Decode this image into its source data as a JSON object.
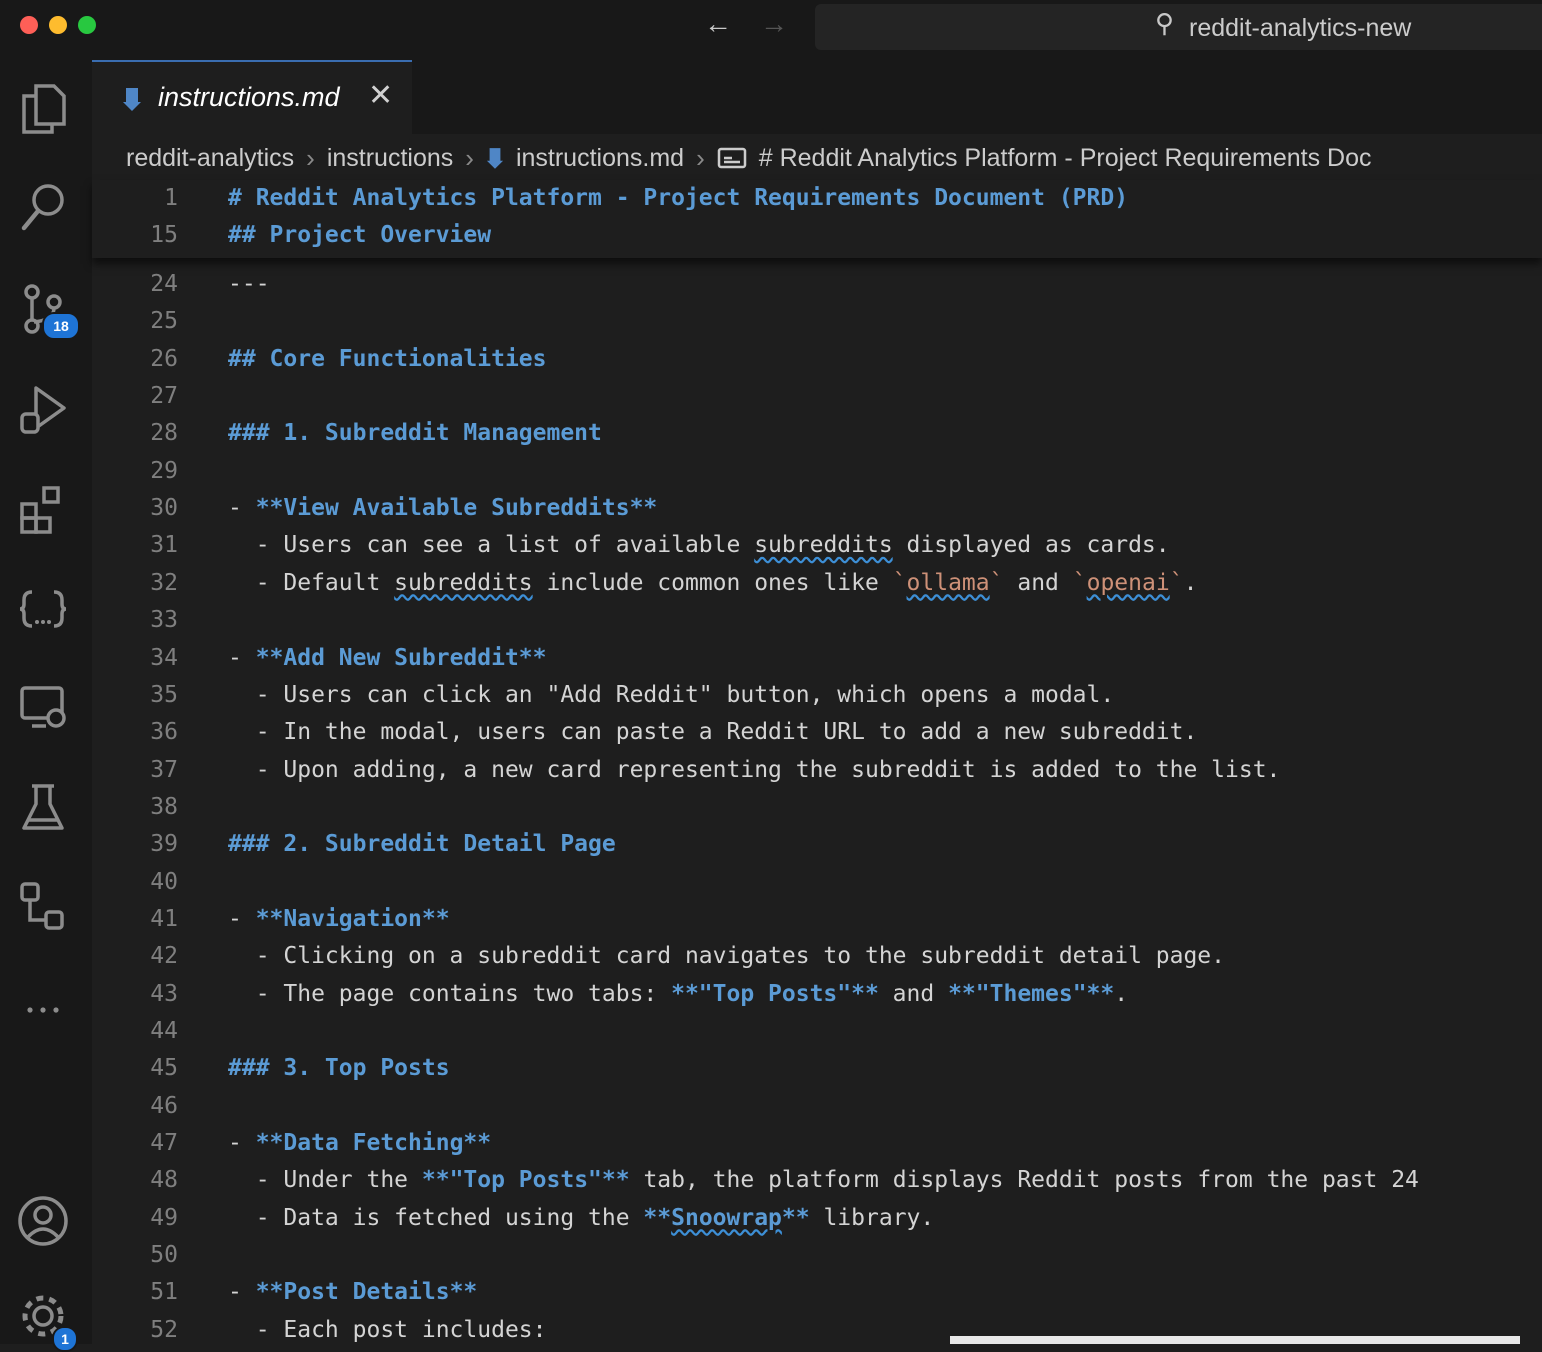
{
  "window": {
    "search_text": "reddit-analytics-new"
  },
  "tab": {
    "title": "instructions.md",
    "close": "✕"
  },
  "breadcrumb": [
    "reddit-analytics",
    "instructions",
    "instructions.md",
    "# Reddit Analytics Platform - Project Requirements Doc"
  ],
  "activity_badges": {
    "source_control": "18",
    "settings": "1"
  },
  "sticky_lines": [
    {
      "n": "1",
      "text": "# Reddit Analytics Platform - Project Requirements Document (PRD)"
    },
    {
      "n": "15",
      "text": "## Project Overview"
    }
  ],
  "lines": [
    {
      "n": "24",
      "text": "---"
    },
    {
      "n": "25",
      "text": ""
    },
    {
      "n": "26",
      "text": "## Core Functionalities"
    },
    {
      "n": "27",
      "text": ""
    },
    {
      "n": "28",
      "text": "### 1. Subreddit Management"
    },
    {
      "n": "29",
      "text": ""
    },
    {
      "n": "30",
      "text": "- **View Available Subreddits**"
    },
    {
      "n": "31",
      "text": "  - Users can see a list of available subreddits displayed as cards."
    },
    {
      "n": "32",
      "text": "  - Default subreddits include common ones like `ollama` and `openai`."
    },
    {
      "n": "33",
      "text": ""
    },
    {
      "n": "34",
      "text": "- **Add New Subreddit**"
    },
    {
      "n": "35",
      "text": "  - Users can click an \"Add Reddit\" button, which opens a modal."
    },
    {
      "n": "36",
      "text": "  - In the modal, users can paste a Reddit URL to add a new subreddit."
    },
    {
      "n": "37",
      "text": "  - Upon adding, a new card representing the subreddit is added to the list."
    },
    {
      "n": "38",
      "text": ""
    },
    {
      "n": "39",
      "text": "### 2. Subreddit Detail Page"
    },
    {
      "n": "40",
      "text": ""
    },
    {
      "n": "41",
      "text": "- **Navigation**"
    },
    {
      "n": "42",
      "text": "  - Clicking on a subreddit card navigates to the subreddit detail page."
    },
    {
      "n": "43",
      "text": "  - The page contains two tabs: **\"Top Posts\"** and **\"Themes\"**."
    },
    {
      "n": "44",
      "text": ""
    },
    {
      "n": "45",
      "text": "### 3. Top Posts"
    },
    {
      "n": "46",
      "text": ""
    },
    {
      "n": "47",
      "text": "- **Data Fetching**"
    },
    {
      "n": "48",
      "text": "  - Under the **\"Top Posts\"** tab, the platform displays Reddit posts from the past 24"
    },
    {
      "n": "49",
      "text": "  - Data is fetched using the **Snoowrap** library."
    },
    {
      "n": "50",
      "text": ""
    },
    {
      "n": "51",
      "text": "- **Post Details**"
    },
    {
      "n": "52",
      "text": "  - Each post includes:"
    }
  ],
  "colors": {
    "accent": "#1e74d6",
    "heading": "#5b9bd5",
    "inline_code": "#ce9178"
  }
}
